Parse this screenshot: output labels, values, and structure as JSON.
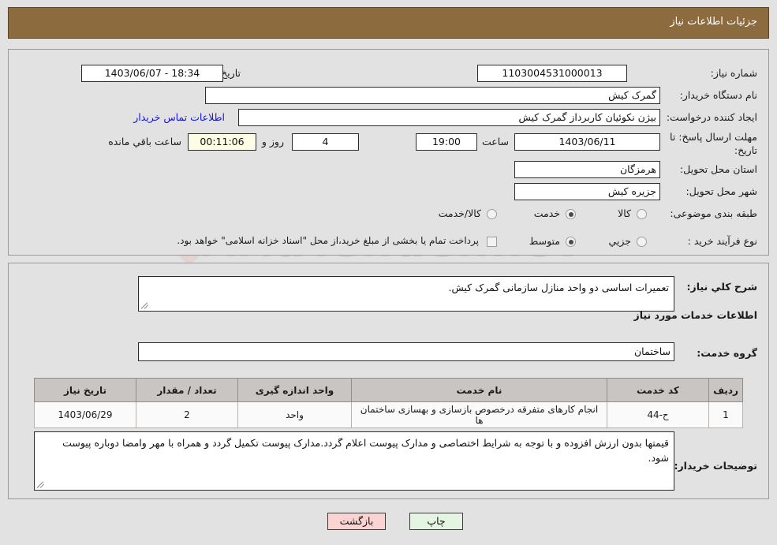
{
  "header": {
    "title": "جزئیات اطلاعات نیاز"
  },
  "watermark": {
    "text": "AriaTender.net"
  },
  "top_form": {
    "need_number_label": "شماره نیاز:",
    "need_number_value": "1103004531000013",
    "announce_label": "تاریخ و ساعت اعلان عمومي:",
    "announce_value": "1403/06/07 - 18:34",
    "buyer_org_label": "نام دستگاه خریدار:",
    "buyer_org_value": "گمرک کیش",
    "creator_label": "ایجاد کننده درخواست:",
    "creator_value": "بیژن نکوئیان کاربرداز گمرک کیش",
    "contact_link": "اطلاعات تماس خریدار",
    "deadline_label_line1": "مهلت ارسال پاسخ: تا",
    "deadline_label_line2": "تاریخ:",
    "deadline_date": "1403/06/11",
    "hour_label": "ساعت",
    "deadline_time": "19:00",
    "days_value": "4",
    "days_label": "روز و",
    "timer_value": "00:11:06",
    "remaining_label": "ساعت باقي مانده",
    "province_label": "استان محل تحویل:",
    "province_value": "هرمزگان",
    "city_label": "شهر محل تحویل:",
    "city_value": "جزیره کیش",
    "category_label": "طبقه بندی موضوعی:",
    "category_options": [
      {
        "label": "کالا",
        "selected": false
      },
      {
        "label": "خدمت",
        "selected": true
      },
      {
        "label": "کالا/خدمت",
        "selected": false
      }
    ],
    "process_label": "نوع فرآیند خرید :",
    "process_options": [
      {
        "label": "جزیي",
        "selected": false
      },
      {
        "label": "متوسط",
        "selected": true
      }
    ],
    "treasury_checkbox_label": "پرداخت تمام یا بخشی از مبلغ خرید،از محل \"اسناد خزانه اسلامی\" خواهد بود.",
    "treasury_checked": false
  },
  "middle": {
    "summary_label": "شرح کلي نیاز:",
    "summary_value": "تعمیرات اساسی دو واحد منازل سازمانی گمرک کیش.",
    "services_section_title": "اطلاعات خدمات مورد نیاز",
    "service_group_label": "گروه خدمت:",
    "service_group_value": "ساختمان"
  },
  "table": {
    "columns": [
      "ردیف",
      "کد خدمت",
      "نام خدمت",
      "واحد اندازه گیری",
      "تعداد / مقدار",
      "تاریخ نیاز"
    ],
    "rows": [
      {
        "row_no": "1",
        "service_code": "ح-44",
        "service_name": "انجام کارهای متفرقه درخصوص بازسازی و بهسازی ساختمان ها",
        "unit": "واحد",
        "quantity": "2",
        "need_date": "1403/06/29"
      }
    ]
  },
  "notes": {
    "label": "توضیحات خریدار:",
    "value": "قیمتها بدون ارزش افزوده و با توجه به شرایط اختصاصی و مدارک پیوست اعلام گردد.مدارک پیوست تکمیل گردد و همراه با مهر وامضا دوباره پیوست شود."
  },
  "footer": {
    "back_button": "بازگشت",
    "print_button": "چاپ"
  }
}
